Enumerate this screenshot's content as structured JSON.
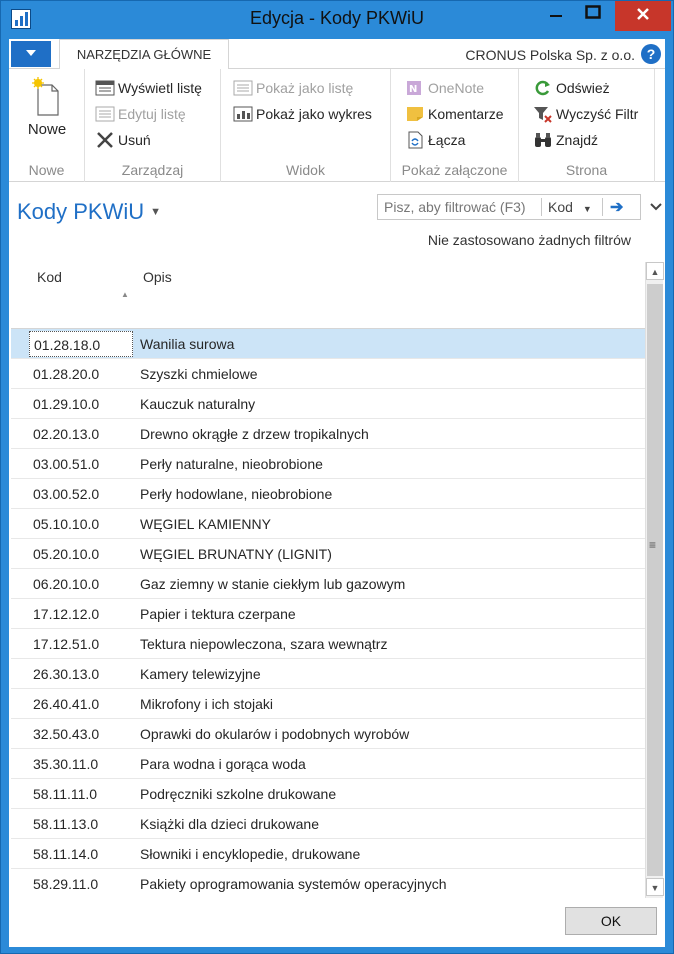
{
  "window": {
    "title": "Edycja - Kody PKWiU"
  },
  "ribbon": {
    "tab_home": "NARZĘDZIA GŁÓWNE",
    "company": "CRONUS Polska Sp. z o.o.",
    "help": "?",
    "groups": {
      "nowe": {
        "label": "Nowe",
        "new_label": "Nowe"
      },
      "zarzadzaj": {
        "label": "Zarządzaj",
        "view_list": "Wyświetl listę",
        "edit_list": "Edytuj listę",
        "delete": "Usuń"
      },
      "widok": {
        "label": "Widok",
        "show_list": "Pokaż jako listę",
        "show_chart": "Pokaż jako wykres"
      },
      "zalaczone": {
        "label": "Pokaż załączone",
        "onenote": "OneNote",
        "comments": "Komentarze",
        "links": "Łącza"
      },
      "strona": {
        "label": "Strona",
        "refresh": "Odśwież",
        "clear_filter": "Wyczyść Filtr",
        "find": "Znajdź"
      }
    }
  },
  "page": {
    "title": "Kody PKWiU",
    "filter_placeholder": "Pisz, aby filtrować (F3)",
    "filter_field": "Kod",
    "no_filters": "Nie zastosowano żadnych filtrów"
  },
  "grid": {
    "headers": {
      "kod": "Kod",
      "opis": "Opis"
    },
    "rows": [
      {
        "kod": "01.28.18.0",
        "opis": "Wanilia surowa"
      },
      {
        "kod": "01.28.20.0",
        "opis": "Szyszki chmielowe"
      },
      {
        "kod": "01.29.10.0",
        "opis": "Kauczuk naturalny"
      },
      {
        "kod": "02.20.13.0",
        "opis": "Drewno okrągłe z drzew tropikalnych"
      },
      {
        "kod": "03.00.51.0",
        "opis": "Perły naturalne, nieobrobione"
      },
      {
        "kod": "03.00.52.0",
        "opis": "Perły hodowlane, nieobrobione"
      },
      {
        "kod": "05.10.10.0",
        "opis": "WĘGIEL KAMIENNY"
      },
      {
        "kod": "05.20.10.0",
        "opis": "WĘGIEL BRUNATNY (LIGNIT)"
      },
      {
        "kod": "06.20.10.0",
        "opis": "Gaz ziemny w stanie ciekłym lub gazowym"
      },
      {
        "kod": "17.12.12.0",
        "opis": "Papier i tektura czerpane"
      },
      {
        "kod": "17.12.51.0",
        "opis": "Tektura niepowleczona, szara wewnątrz"
      },
      {
        "kod": "26.30.13.0",
        "opis": "Kamery telewizyjne"
      },
      {
        "kod": "26.40.41.0",
        "opis": "Mikrofony i ich stojaki"
      },
      {
        "kod": "32.50.43.0",
        "opis": "Oprawki do okularów i podobnych wyrobów"
      },
      {
        "kod": "35.30.11.0",
        "opis": "Para wodna i gorąca woda"
      },
      {
        "kod": "58.11.11.0",
        "opis": "Podręczniki szkolne drukowane"
      },
      {
        "kod": "58.11.13.0",
        "opis": "Książki dla dzieci drukowane"
      },
      {
        "kod": "58.11.14.0",
        "opis": "Słowniki i encyklopedie, drukowane"
      },
      {
        "kod": "58.29.11.0",
        "opis": "Pakiety oprogramowania systemów operacyjnych"
      }
    ]
  },
  "footer": {
    "ok": "OK"
  },
  "colors": {
    "accent": "#1f6fc6",
    "titlebar": "#2b8ad8",
    "selected_row": "#cce4f7",
    "close": "#c7362a"
  }
}
